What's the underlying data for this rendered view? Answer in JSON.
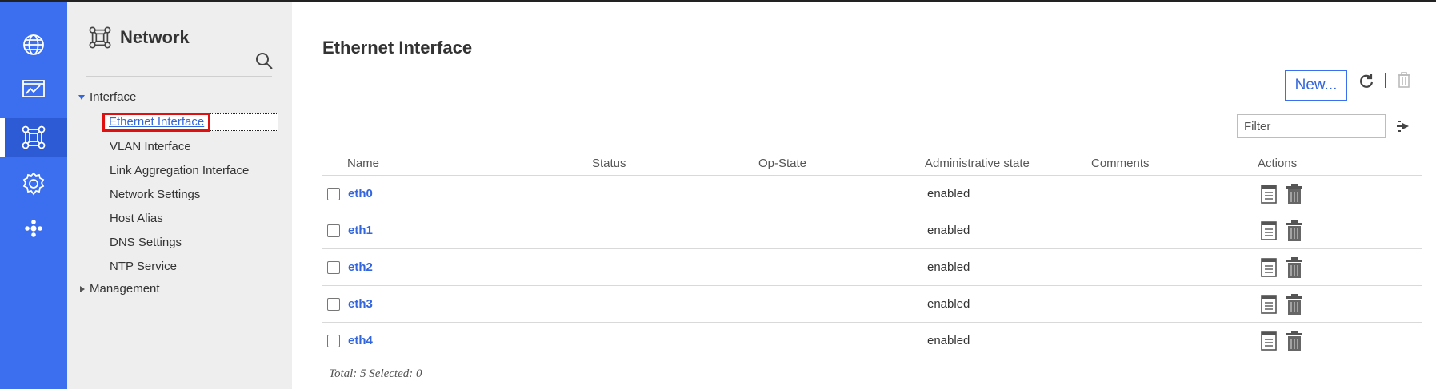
{
  "colors": {
    "rail": "#3c6ff0",
    "rail_active": "#2d5bd6",
    "nav_bg": "#eeeeee",
    "link": "#3366dd",
    "highlight": "#e01010"
  },
  "rail": [
    {
      "icon": "globe-icon"
    },
    {
      "icon": "chart-icon"
    },
    {
      "icon": "network-icon",
      "active": true
    },
    {
      "icon": "gear-icon"
    },
    {
      "icon": "cluster-icon"
    }
  ],
  "nav": {
    "title": "Network",
    "title_icon": "network-icon",
    "search_icon": "search-icon",
    "groups": [
      {
        "label": "Interface",
        "expanded": true,
        "items": [
          "Ethernet Interface",
          "VLAN Interface",
          "Link Aggregation Interface",
          "Network Settings",
          "Host Alias",
          "DNS Settings",
          "NTP Service"
        ]
      },
      {
        "label": "Management",
        "expanded": false
      }
    ],
    "selected": "Ethernet Interface"
  },
  "main": {
    "title": "Ethernet Interface",
    "new_button": "New...",
    "toolbar_icons": [
      "refresh-icon",
      "delete-icon"
    ],
    "filter_placeholder": "Filter",
    "filter_action_icon": "apply-filter-icon",
    "columns": [
      "Name",
      "Status",
      "Op-State",
      "Administrative state",
      "Comments",
      "Actions"
    ],
    "rows": [
      {
        "name": "eth0",
        "status": "",
        "op_state": "",
        "admin_state": "enabled",
        "comments": ""
      },
      {
        "name": "eth1",
        "status": "",
        "op_state": "",
        "admin_state": "enabled",
        "comments": ""
      },
      {
        "name": "eth2",
        "status": "",
        "op_state": "",
        "admin_state": "enabled",
        "comments": ""
      },
      {
        "name": "eth3",
        "status": "",
        "op_state": "",
        "admin_state": "enabled",
        "comments": ""
      },
      {
        "name": "eth4",
        "status": "",
        "op_state": "",
        "admin_state": "enabled",
        "comments": ""
      }
    ],
    "row_actions": [
      "edit-icon",
      "trash-icon"
    ],
    "footer": "Total: 5 Selected: 0"
  }
}
